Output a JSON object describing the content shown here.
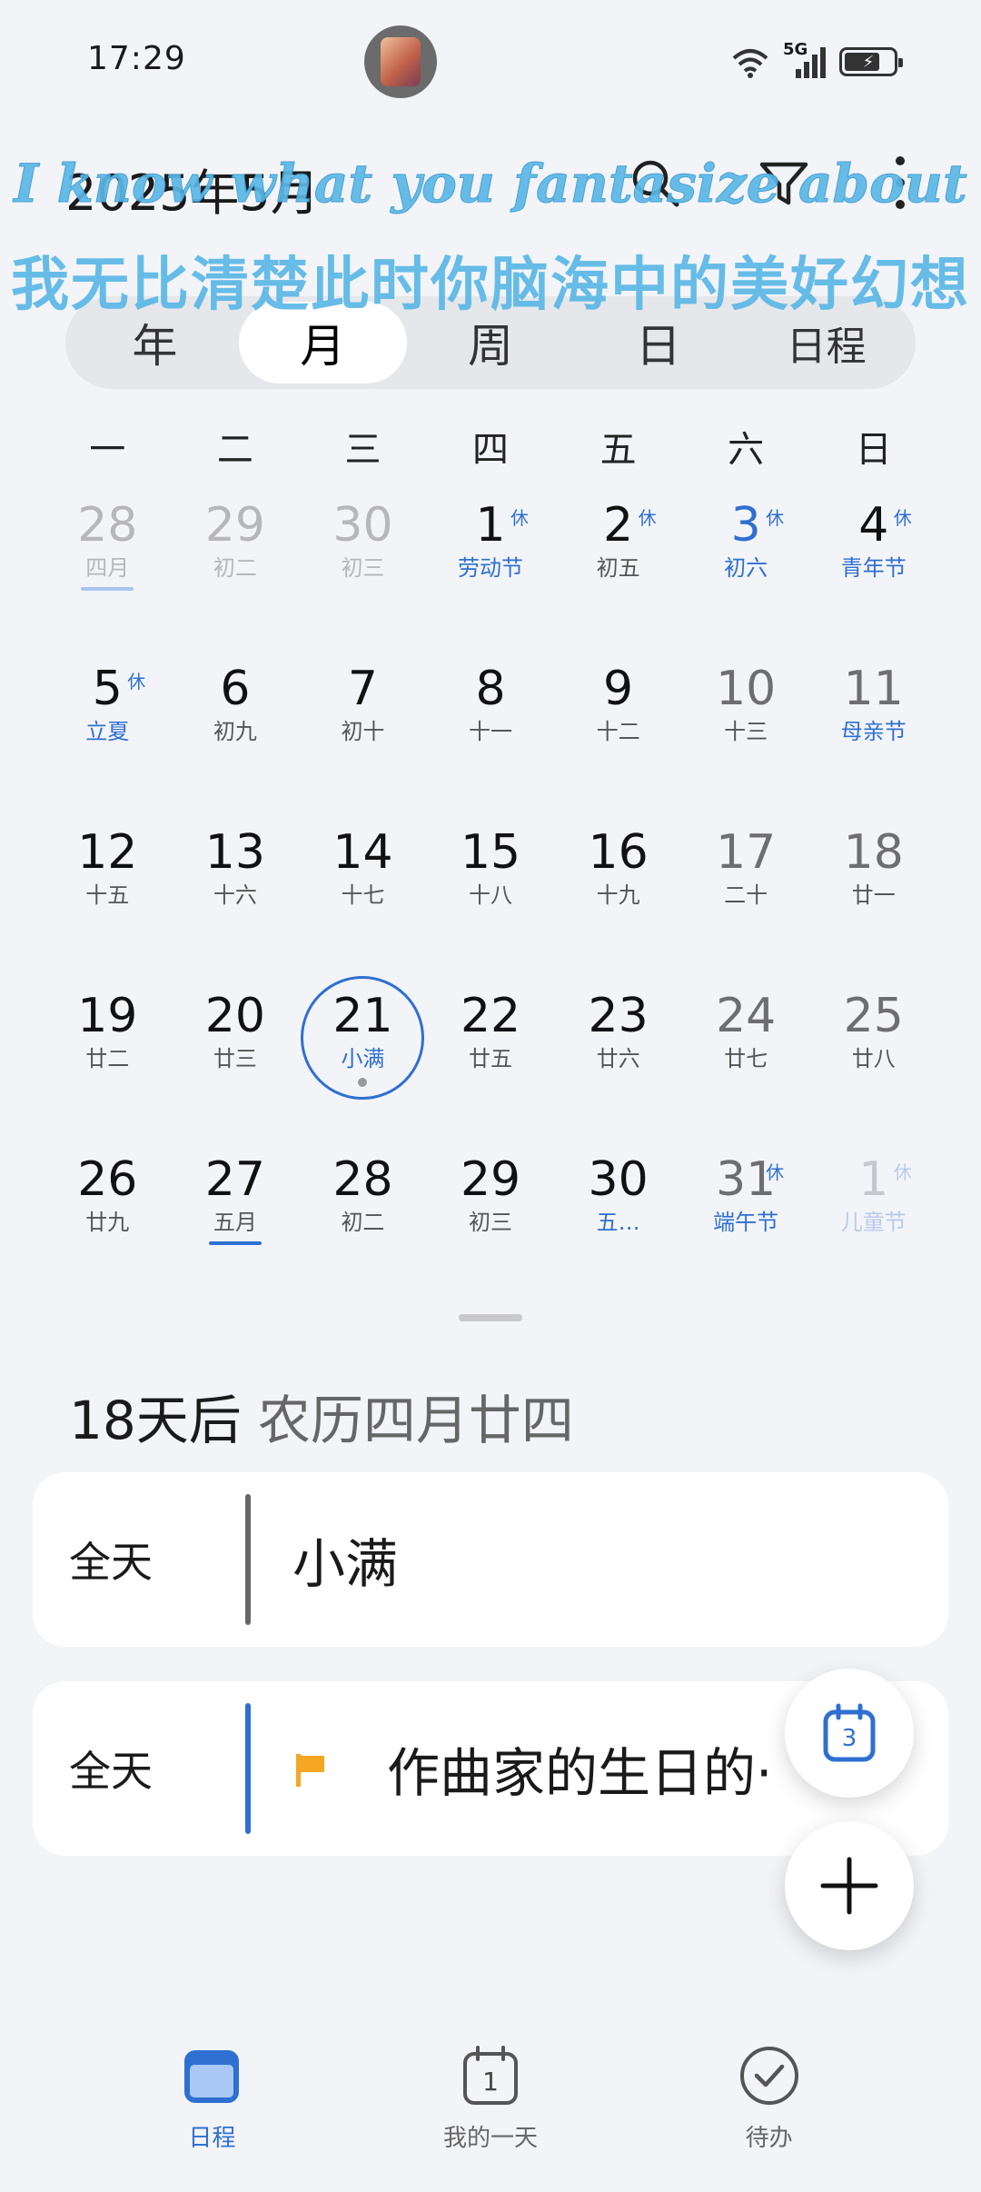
{
  "status_bar": {
    "time": "17:29",
    "network": "5G"
  },
  "header": {
    "month_title": "2025年5月"
  },
  "overlay": {
    "english": "I know what you fantasize about",
    "chinese": "我无比清楚此时你脑海中的美好幻想"
  },
  "view_tabs": [
    {
      "label": "年",
      "active": false
    },
    {
      "label": "月",
      "active": true
    },
    {
      "label": "周",
      "active": false
    },
    {
      "label": "日",
      "active": false
    },
    {
      "label": "日程",
      "active": false
    }
  ],
  "weekdays": [
    "一",
    "二",
    "三",
    "四",
    "五",
    "六",
    "日"
  ],
  "weeks": [
    [
      {
        "num": "28",
        "sub": "四月",
        "style": "dim",
        "uline": "light"
      },
      {
        "num": "29",
        "sub": "初二",
        "style": "dim"
      },
      {
        "num": "30",
        "sub": "初三",
        "style": "dim"
      },
      {
        "num": "1",
        "sub": "劳动节",
        "rest": "休",
        "sub_blue": true
      },
      {
        "num": "2",
        "sub": "初五",
        "rest": "休"
      },
      {
        "num": "3",
        "sub": "初六",
        "rest": "休",
        "num_blue": true,
        "sub_blue": true
      },
      {
        "num": "4",
        "sub": "青年节",
        "rest": "休",
        "sub_blue": true
      }
    ],
    [
      {
        "num": "5",
        "sub": "立夏",
        "rest": "休",
        "sub_blue": true
      },
      {
        "num": "6",
        "sub": "初九"
      },
      {
        "num": "7",
        "sub": "初十"
      },
      {
        "num": "8",
        "sub": "十一"
      },
      {
        "num": "9",
        "sub": "十二"
      },
      {
        "num": "10",
        "sub": "十三",
        "style": "weekend"
      },
      {
        "num": "11",
        "sub": "母亲节",
        "style": "weekend",
        "sub_blue": true
      }
    ],
    [
      {
        "num": "12",
        "sub": "十五"
      },
      {
        "num": "13",
        "sub": "十六"
      },
      {
        "num": "14",
        "sub": "十七"
      },
      {
        "num": "15",
        "sub": "十八"
      },
      {
        "num": "16",
        "sub": "十九"
      },
      {
        "num": "17",
        "sub": "二十",
        "style": "weekend"
      },
      {
        "num": "18",
        "sub": "廿一",
        "style": "weekend"
      }
    ],
    [
      {
        "num": "19",
        "sub": "廿二"
      },
      {
        "num": "20",
        "sub": "廿三"
      },
      {
        "num": "21",
        "sub": "小满",
        "today": true,
        "sub_blue": true
      },
      {
        "num": "22",
        "sub": "廿五"
      },
      {
        "num": "23",
        "sub": "廿六"
      },
      {
        "num": "24",
        "sub": "廿七",
        "style": "weekend"
      },
      {
        "num": "25",
        "sub": "廿八",
        "style": "weekend"
      }
    ],
    [
      {
        "num": "26",
        "sub": "廿九"
      },
      {
        "num": "27",
        "sub": "五月",
        "uline": "dark"
      },
      {
        "num": "28",
        "sub": "初二"
      },
      {
        "num": "29",
        "sub": "初三"
      },
      {
        "num": "30",
        "sub": "五…",
        "sub_blue": true
      },
      {
        "num": "31",
        "sub": "端午节",
        "rest": "休",
        "style": "weekend",
        "sub_blue": true
      },
      {
        "num": "1",
        "sub": "儿童节",
        "rest": "休",
        "style": "faded"
      }
    ]
  ],
  "date_info": {
    "countdown": "18天后",
    "lunar": "农历四月廿四"
  },
  "events": [
    {
      "when": "全天",
      "title": "小满",
      "bar_color": "#666666"
    },
    {
      "when": "全天",
      "title": "作曲家的生日的·",
      "bar_color": "#2f6fd1",
      "flag_color": "#f5a623"
    }
  ],
  "fab": {
    "calendar_badge": "3"
  },
  "bottom_nav": [
    {
      "label": "日程",
      "icon": "calendar-icon",
      "active": true
    },
    {
      "label": "我的一天",
      "icon": "my-day-icon",
      "badge": "1",
      "active": false
    },
    {
      "label": "待办",
      "icon": "todo-check-icon",
      "active": false
    }
  ],
  "colors": {
    "accent": "#2f6fd1",
    "background": "#f3f4f8",
    "overlay_text": "#5bb8e6"
  }
}
